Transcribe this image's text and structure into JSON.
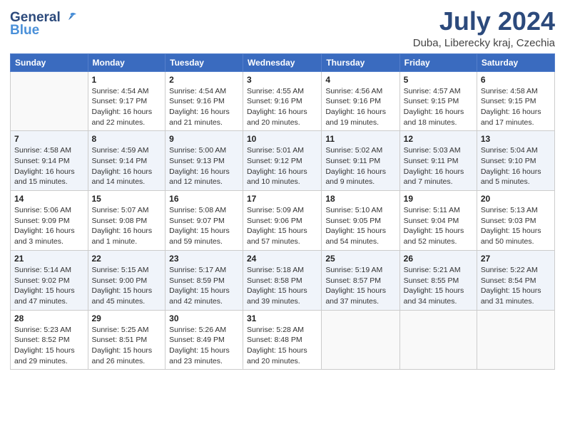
{
  "logo": {
    "line1": "General",
    "line2": "Blue"
  },
  "title": "July 2024",
  "subtitle": "Duba, Liberecky kraj, Czechia",
  "header": {
    "days": [
      "Sunday",
      "Monday",
      "Tuesday",
      "Wednesday",
      "Thursday",
      "Friday",
      "Saturday"
    ]
  },
  "weeks": [
    {
      "cells": [
        {
          "day": "",
          "info": ""
        },
        {
          "day": "1",
          "info": "Sunrise: 4:54 AM\nSunset: 9:17 PM\nDaylight: 16 hours\nand 22 minutes."
        },
        {
          "day": "2",
          "info": "Sunrise: 4:54 AM\nSunset: 9:16 PM\nDaylight: 16 hours\nand 21 minutes."
        },
        {
          "day": "3",
          "info": "Sunrise: 4:55 AM\nSunset: 9:16 PM\nDaylight: 16 hours\nand 20 minutes."
        },
        {
          "day": "4",
          "info": "Sunrise: 4:56 AM\nSunset: 9:16 PM\nDaylight: 16 hours\nand 19 minutes."
        },
        {
          "day": "5",
          "info": "Sunrise: 4:57 AM\nSunset: 9:15 PM\nDaylight: 16 hours\nand 18 minutes."
        },
        {
          "day": "6",
          "info": "Sunrise: 4:58 AM\nSunset: 9:15 PM\nDaylight: 16 hours\nand 17 minutes."
        }
      ]
    },
    {
      "cells": [
        {
          "day": "7",
          "info": "Sunrise: 4:58 AM\nSunset: 9:14 PM\nDaylight: 16 hours\nand 15 minutes."
        },
        {
          "day": "8",
          "info": "Sunrise: 4:59 AM\nSunset: 9:14 PM\nDaylight: 16 hours\nand 14 minutes."
        },
        {
          "day": "9",
          "info": "Sunrise: 5:00 AM\nSunset: 9:13 PM\nDaylight: 16 hours\nand 12 minutes."
        },
        {
          "day": "10",
          "info": "Sunrise: 5:01 AM\nSunset: 9:12 PM\nDaylight: 16 hours\nand 10 minutes."
        },
        {
          "day": "11",
          "info": "Sunrise: 5:02 AM\nSunset: 9:11 PM\nDaylight: 16 hours\nand 9 minutes."
        },
        {
          "day": "12",
          "info": "Sunrise: 5:03 AM\nSunset: 9:11 PM\nDaylight: 16 hours\nand 7 minutes."
        },
        {
          "day": "13",
          "info": "Sunrise: 5:04 AM\nSunset: 9:10 PM\nDaylight: 16 hours\nand 5 minutes."
        }
      ]
    },
    {
      "cells": [
        {
          "day": "14",
          "info": "Sunrise: 5:06 AM\nSunset: 9:09 PM\nDaylight: 16 hours\nand 3 minutes."
        },
        {
          "day": "15",
          "info": "Sunrise: 5:07 AM\nSunset: 9:08 PM\nDaylight: 16 hours\nand 1 minute."
        },
        {
          "day": "16",
          "info": "Sunrise: 5:08 AM\nSunset: 9:07 PM\nDaylight: 15 hours\nand 59 minutes."
        },
        {
          "day": "17",
          "info": "Sunrise: 5:09 AM\nSunset: 9:06 PM\nDaylight: 15 hours\nand 57 minutes."
        },
        {
          "day": "18",
          "info": "Sunrise: 5:10 AM\nSunset: 9:05 PM\nDaylight: 15 hours\nand 54 minutes."
        },
        {
          "day": "19",
          "info": "Sunrise: 5:11 AM\nSunset: 9:04 PM\nDaylight: 15 hours\nand 52 minutes."
        },
        {
          "day": "20",
          "info": "Sunrise: 5:13 AM\nSunset: 9:03 PM\nDaylight: 15 hours\nand 50 minutes."
        }
      ]
    },
    {
      "cells": [
        {
          "day": "21",
          "info": "Sunrise: 5:14 AM\nSunset: 9:02 PM\nDaylight: 15 hours\nand 47 minutes."
        },
        {
          "day": "22",
          "info": "Sunrise: 5:15 AM\nSunset: 9:00 PM\nDaylight: 15 hours\nand 45 minutes."
        },
        {
          "day": "23",
          "info": "Sunrise: 5:17 AM\nSunset: 8:59 PM\nDaylight: 15 hours\nand 42 minutes."
        },
        {
          "day": "24",
          "info": "Sunrise: 5:18 AM\nSunset: 8:58 PM\nDaylight: 15 hours\nand 39 minutes."
        },
        {
          "day": "25",
          "info": "Sunrise: 5:19 AM\nSunset: 8:57 PM\nDaylight: 15 hours\nand 37 minutes."
        },
        {
          "day": "26",
          "info": "Sunrise: 5:21 AM\nSunset: 8:55 PM\nDaylight: 15 hours\nand 34 minutes."
        },
        {
          "day": "27",
          "info": "Sunrise: 5:22 AM\nSunset: 8:54 PM\nDaylight: 15 hours\nand 31 minutes."
        }
      ]
    },
    {
      "cells": [
        {
          "day": "28",
          "info": "Sunrise: 5:23 AM\nSunset: 8:52 PM\nDaylight: 15 hours\nand 29 minutes."
        },
        {
          "day": "29",
          "info": "Sunrise: 5:25 AM\nSunset: 8:51 PM\nDaylight: 15 hours\nand 26 minutes."
        },
        {
          "day": "30",
          "info": "Sunrise: 5:26 AM\nSunset: 8:49 PM\nDaylight: 15 hours\nand 23 minutes."
        },
        {
          "day": "31",
          "info": "Sunrise: 5:28 AM\nSunset: 8:48 PM\nDaylight: 15 hours\nand 20 minutes."
        },
        {
          "day": "",
          "info": ""
        },
        {
          "day": "",
          "info": ""
        },
        {
          "day": "",
          "info": ""
        }
      ]
    }
  ]
}
